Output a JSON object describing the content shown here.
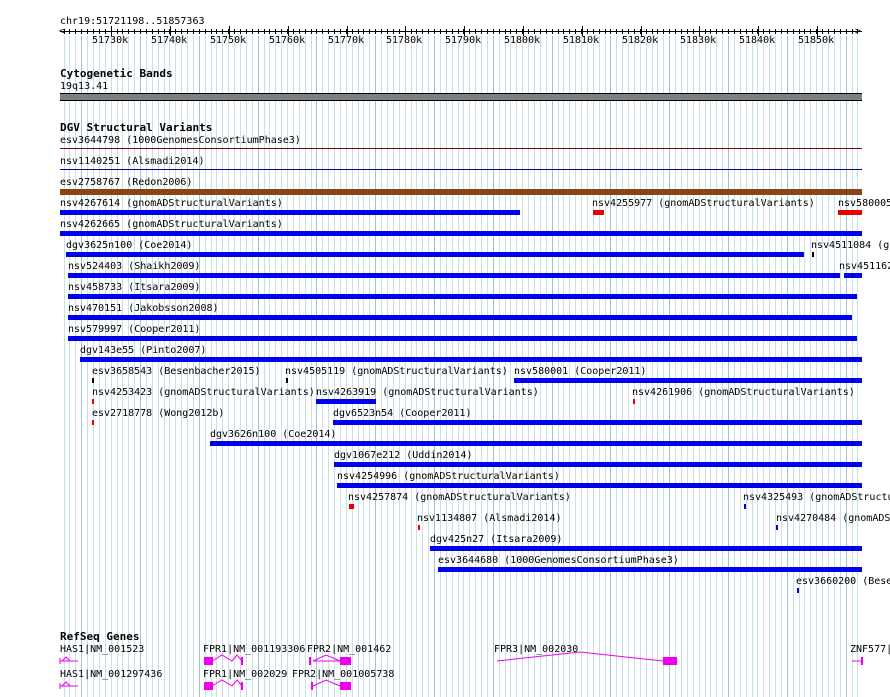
{
  "ruler": {
    "range_label": "chr19:51721198..51857363",
    "ticks": [
      "51730k",
      "51740k",
      "51750k",
      "51760k",
      "51770k",
      "51780k",
      "51790k",
      "51800k",
      "51810k",
      "51820k",
      "51830k",
      "51840k",
      "51850k"
    ]
  },
  "cyto": {
    "title": "Cytogenetic Bands",
    "band": "19q13.41",
    "color": "#808080"
  },
  "dgv": {
    "title": "DGV Structural Variants",
    "features": [
      {
        "label": "esv3644798 (1000GenomesConsortiumPhase3)",
        "color": "#8b0000",
        "thin": true
      },
      {
        "label": "nsv1140251 (Alsmadi2014)",
        "color": "#00008b",
        "thin": true
      },
      {
        "label": "esv2758767 (Redon2006)",
        "color": "#8b0000",
        "thin": true
      },
      {
        "label": "",
        "color": "#8b4513"
      },
      {
        "label": "nsv4267614 (gnomADStructuralVariants)",
        "color": "#0000ee"
      },
      {
        "label": "nsv4255977 (gnomADStructuralVariants)",
        "color": "#ee0000"
      },
      {
        "label": "nsv580005",
        "color": "#ee0000"
      },
      {
        "label": "nsv4262665 (gnomADStructuralVariants)",
        "color": "#0000ee"
      },
      {
        "label": "dgv3625n100 (Coe2014)",
        "color": "#0000ee"
      },
      {
        "label": "nsv4511084 (g",
        "color": "#0000ee"
      },
      {
        "label": "nsv524403 (Shaikh2009)",
        "color": "#0000ee"
      },
      {
        "label": "nsv451162",
        "color": "#0000ee"
      },
      {
        "label": "nsv458733 (Itsara2009)",
        "color": "#0000ee"
      },
      {
        "label": "nsv470151 (Jakobsson2008)",
        "color": "#0000ee"
      },
      {
        "label": "nsv579997 (Cooper2011)",
        "color": "#0000ee"
      },
      {
        "label": "dgv143e55 (Pinto2007)",
        "color": "#0000ee"
      },
      {
        "label": "esv3658543 (Besenbacher2015)",
        "color": "#000000"
      },
      {
        "label": "nsv4505119 (gnomADStructuralVariants)",
        "color": "#000000"
      },
      {
        "label": "nsv580001 (Cooper2011)",
        "color": "#0000ee"
      },
      {
        "label": "nsv4253423 (gnomADStructuralVariants)",
        "color": "#ee0000"
      },
      {
        "label": "nsv4263919 (gnomADStructuralVariants)",
        "color": "#0000ee"
      },
      {
        "label": "nsv4261906 (gnomADStructuralVariants)",
        "color": "#ee0000"
      },
      {
        "label": "esv2718778 (Wong2012b)",
        "color": "#ee0000"
      },
      {
        "label": "dgv6523n54 (Cooper2011)",
        "color": "#0000ee"
      },
      {
        "label": "dgv3626n100 (Coe2014)",
        "color": "#0000ee"
      },
      {
        "label": "dgv1067e212 (Uddin2014)",
        "color": "#0000ee"
      },
      {
        "label": "nsv4254996 (gnomADStructuralVariants)",
        "color": "#0000ee"
      },
      {
        "label": "nsv4257874 (gnomADStructuralVariants)",
        "color": "#ee0000"
      },
      {
        "label": "nsv4325493 (gnomADStructu",
        "color": "#0000ee"
      },
      {
        "label": "nsv1134807 (Alsmadi2014)",
        "color": "#ee0000"
      },
      {
        "label": "nsv4270484 (gnomADS",
        "color": "#0000ee"
      },
      {
        "label": "dgv425n27 (Itsara2009)",
        "color": "#0000ee"
      },
      {
        "label": "esv3644680 (1000GenomesConsortiumPhase3)",
        "color": "#0000ee"
      },
      {
        "label": "esv3660200 (Bese",
        "color": "#0000ee"
      }
    ]
  },
  "refseq": {
    "title": "RefSeq Genes",
    "color": "#ee00ee",
    "genes": [
      {
        "label": "HAS1|NM_001523"
      },
      {
        "label": "FPR1|NM_001193306"
      },
      {
        "label": "FPR2|NM_001462"
      },
      {
        "label": "FPR3|NM_002030"
      },
      {
        "label": "ZNF577|"
      },
      {
        "label": "HAS1|NM_001297436"
      },
      {
        "label": "FPR1|NM_002029"
      },
      {
        "label": "FPR2|NM_001005738"
      }
    ]
  }
}
